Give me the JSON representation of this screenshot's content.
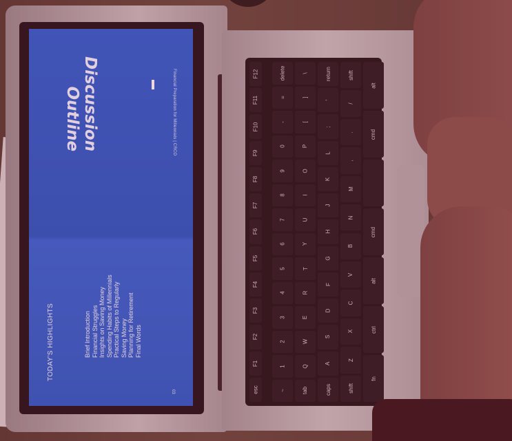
{
  "slide": {
    "title_line1": "Discussion",
    "title_line2": "Outline",
    "subtitle": "Financial Preparation for Millennials | CRCO",
    "highlights_heading": "TODAY'S HIGHLIGHTS",
    "highlights": [
      "Brief Introduction",
      "Financial Struggles",
      "Insights on Saving Money",
      "Spending Habits of Millennials",
      "Practical Steps to Regularly",
      "Saving Money",
      "Planning for Retirement",
      "Final Words"
    ],
    "page_number": "03"
  },
  "keyboard": {
    "rows": [
      [
        "esc",
        "F1",
        "F2",
        "F3",
        "F4",
        "F5",
        "F6",
        "F7",
        "F8",
        "F9",
        "F10",
        "F11",
        "F12"
      ],
      [
        "~",
        "1",
        "2",
        "3",
        "4",
        "5",
        "6",
        "7",
        "8",
        "9",
        "0",
        "-",
        "=",
        "delete"
      ],
      [
        "tab",
        "Q",
        "W",
        "E",
        "R",
        "T",
        "Y",
        "U",
        "I",
        "O",
        "P",
        "[",
        "]",
        "\\"
      ],
      [
        "caps",
        "A",
        "S",
        "D",
        "F",
        "G",
        "H",
        "J",
        "K",
        "L",
        ";",
        "'",
        "return"
      ],
      [
        "shift",
        "Z",
        "X",
        "C",
        "V",
        "B",
        "N",
        "M",
        ",",
        ".",
        "/",
        "shift"
      ],
      [
        "fn",
        "ctrl",
        "alt",
        "cmd",
        "",
        "cmd",
        "alt"
      ]
    ]
  }
}
